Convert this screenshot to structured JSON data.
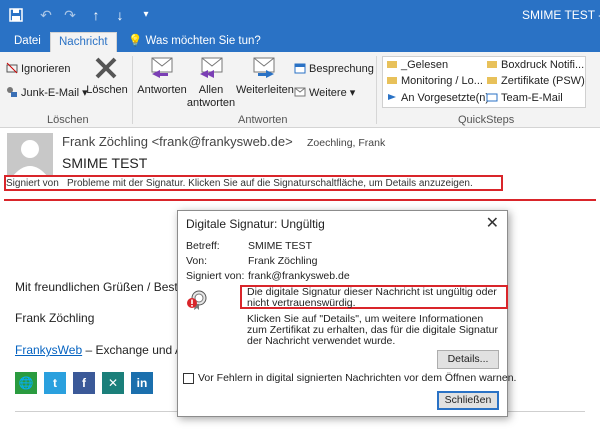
{
  "window": {
    "title": "SMIME TEST - N",
    "quick_access": [
      "save-icon",
      "undo-icon",
      "redo-icon",
      "up-arrow-icon",
      "down-arrow-icon",
      "customize-icon"
    ]
  },
  "ribbon": {
    "tabs": [
      "Datei",
      "Nachricht"
    ],
    "tell_me": "Was möchten Sie tun?",
    "loeschen_group": {
      "ignore": "Ignorieren",
      "junk": "Junk-E-Mail",
      "delete": "Löschen",
      "label": "Löschen"
    },
    "antworten_group": {
      "reply": "Antworten",
      "reply_all_line1": "Allen",
      "reply_all_line2": "antworten",
      "forward": "Weiterleiten",
      "meeting": "Besprechung",
      "more": "Weitere",
      "label": "Antworten"
    },
    "quicksteps": {
      "items": [
        "_Gelesen",
        "Monitoring / Lo...",
        "An Vorgesetzte(n)",
        "Boxdruck Notifi...",
        "Zertifikate (PSW)",
        "Team-E-Mail"
      ],
      "label": "QuickSteps"
    }
  },
  "message": {
    "from": "Frank Zöchling <frank@frankysweb.de>",
    "to": "Zoechling, Frank",
    "subject": "SMIME TEST",
    "signature_label": "Signiert von",
    "signature_message": "Probleme mit der Signatur. Klicken Sie auf die Signaturschaltfläche, um Details anzuzeigen.",
    "body_greeting": "Mit freundlichen Grüßen / Best r",
    "body_name": "Frank Zöchling",
    "body_link": "FrankysWeb",
    "body_link_suffix": " – Exchange und Act",
    "social": [
      "globe-icon",
      "twitter-icon",
      "facebook-icon",
      "xing-icon",
      "linkedin-icon"
    ]
  },
  "dialog": {
    "title": "Digitale Signatur: Ungültig",
    "fields": {
      "subject_label": "Betreff:",
      "subject_value": "SMIME TEST",
      "from_label": "Von:",
      "from_value": "Frank Zöchling",
      "signed_label": "Signiert von:",
      "signed_value": "frank@frankysweb.de"
    },
    "warning": "Die digitale Signatur dieser Nachricht ist ungültig oder nicht vertrauenswürdig.",
    "info": "Klicken Sie auf \"Details\", um weitere Informationen zum Zertifikat zu erhalten, das für die digitale Signatur der Nachricht verwendet wurde.",
    "details_button": "Details...",
    "checkbox_label": "Vor Fehlern in digital signierten Nachrichten vor dem Öffnen warnen.",
    "close_button": "Schließen"
  },
  "colors": {
    "accent": "#2a72c5",
    "alert_red": "#d9252a"
  }
}
